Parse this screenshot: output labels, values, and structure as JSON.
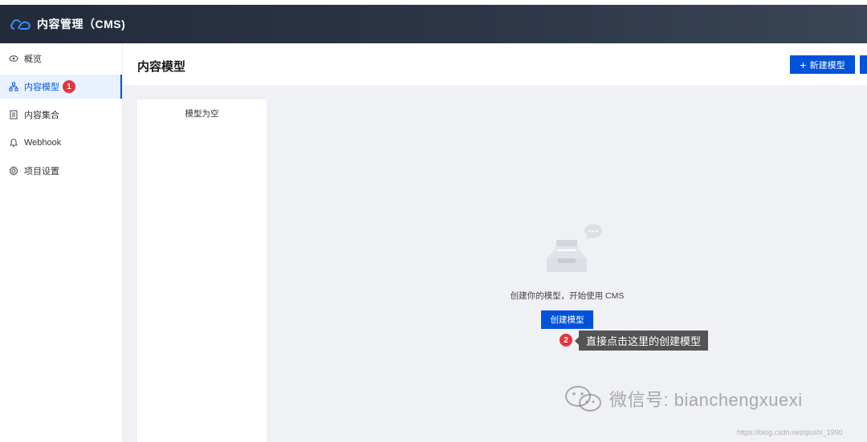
{
  "app": {
    "title": "内容管理（CMS)"
  },
  "sidebar": {
    "items": [
      {
        "label": "概览",
        "icon": "eye-icon"
      },
      {
        "label": "内容模型",
        "icon": "model-icon",
        "badge": "1",
        "active": true
      },
      {
        "label": "内容集合",
        "icon": "document-icon"
      },
      {
        "label": "Webhook",
        "icon": "webhook-icon"
      },
      {
        "label": "项目设置",
        "icon": "gear-icon"
      }
    ]
  },
  "header": {
    "title": "内容模型",
    "new_model_label": "新建模型"
  },
  "model_list": {
    "empty_text": "模型为空"
  },
  "empty_state": {
    "message": "创建你的模型，开始使用 CMS",
    "button_label": "创建模型"
  },
  "annotation": {
    "step": "2",
    "tooltip": "直接点击这里的创建模型"
  },
  "watermark": {
    "text": "微信号: bianchengxuexi",
    "url": "https://blog.csdn.net/qiushi_1990"
  },
  "colors": {
    "primary": "#0052d9",
    "badge": "#e5343c",
    "topbar": "#2c3647",
    "content_bg": "#f0f1f4"
  }
}
